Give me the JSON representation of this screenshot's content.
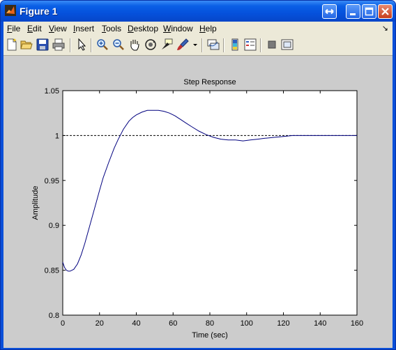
{
  "window": {
    "title": "Figure 1"
  },
  "menu": [
    "File",
    "Edit",
    "View",
    "Insert",
    "Tools",
    "Desktop",
    "Window",
    "Help"
  ],
  "menu_arrow": "↘",
  "toolbar": [
    "new-file-icon",
    "open-folder-icon",
    "save-icon",
    "print-icon",
    "pointer-arrow-icon",
    "zoom-in-icon",
    "zoom-out-icon",
    "pan-hand-icon",
    "rotate-3d-icon",
    "data-cursor-icon",
    "brush-icon",
    "brush-dropdown-icon",
    "link-plot-icon",
    "colorbar-icon",
    "legend-icon",
    "hide-plot-tools-icon",
    "show-plot-tools-icon"
  ],
  "chart_data": {
    "type": "line",
    "title": "Step Response",
    "xlabel": "Time (sec)",
    "ylabel": "Amplitude",
    "xlim": [
      0,
      160
    ],
    "ylim": [
      0.8,
      1.05
    ],
    "xticks": [
      "0",
      "20",
      "40",
      "60",
      "80",
      "100",
      "120",
      "140",
      "160"
    ],
    "yticks": [
      "0.8",
      "0.85",
      "0.9",
      "0.95",
      "1",
      "1.05"
    ],
    "reference_line": {
      "y": 1,
      "style": "dashed",
      "color": "#000000"
    },
    "series": [
      {
        "color": "#00007f",
        "x": [
          0,
          1,
          2,
          3,
          4,
          5,
          6,
          8,
          10,
          12,
          15,
          18,
          20,
          22,
          25,
          28,
          30,
          33,
          36,
          38,
          40,
          43,
          46,
          49,
          52,
          55,
          58,
          61,
          64,
          67,
          70,
          74,
          78,
          82,
          86,
          90,
          94,
          98,
          102,
          106,
          110,
          115,
          120,
          125,
          130,
          140,
          150,
          160
        ],
        "y": [
          0.859,
          0.853,
          0.85,
          0.849,
          0.849,
          0.85,
          0.851,
          0.857,
          0.867,
          0.88,
          0.902,
          0.924,
          0.939,
          0.953,
          0.97,
          0.986,
          0.995,
          1.007,
          1.016,
          1.02,
          1.023,
          1.026,
          1.028,
          1.028,
          1.028,
          1.027,
          1.025,
          1.022,
          1.018,
          1.014,
          1.01,
          1.005,
          1.001,
          0.998,
          0.996,
          0.995,
          0.995,
          0.994,
          0.995,
          0.996,
          0.997,
          0.998,
          0.999,
          1.0,
          1.0,
          1.0,
          1.0,
          1.0
        ]
      }
    ]
  }
}
